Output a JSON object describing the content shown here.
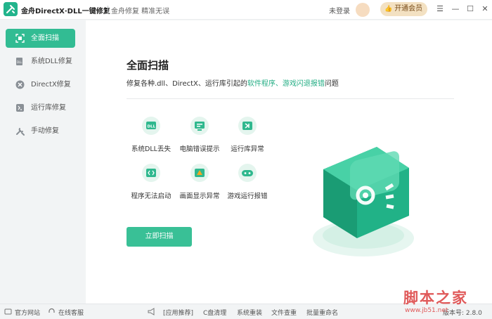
{
  "window": {
    "title": "金舟DirectX·DLL一键修复",
    "slogan": "金舟修复 精准无误",
    "login_label": "未登录",
    "vip_label": "开通会员",
    "controls": [
      "menu-icon",
      "minimize-icon",
      "maximize-icon",
      "close-icon"
    ]
  },
  "sidebar": {
    "items": [
      {
        "label": "全面扫描",
        "icon": "scan-icon",
        "active": true
      },
      {
        "label": "系统DLL修复",
        "icon": "dll-icon",
        "active": false
      },
      {
        "label": "DirectX修复",
        "icon": "directx-icon",
        "active": false
      },
      {
        "label": "运行库修复",
        "icon": "runtime-icon",
        "active": false
      },
      {
        "label": "手动修复",
        "icon": "wrench-icon",
        "active": false
      }
    ]
  },
  "main": {
    "title": "全面扫描",
    "subtitle_prefix": "修复各种.dll、DirectX、运行库引起的",
    "subtitle_highlight": "软件程序、游戏闪退报错",
    "subtitle_suffix": "问题",
    "features": [
      {
        "label": "系统DLL丢失",
        "icon": "dll-file-icon"
      },
      {
        "label": "电脑错误提示",
        "icon": "monitor-error-icon"
      },
      {
        "label": "运行库异常",
        "icon": "vs-runtime-icon"
      },
      {
        "label": "程序无法启动",
        "icon": "code-window-icon"
      },
      {
        "label": "画面显示异常",
        "icon": "warning-display-icon"
      },
      {
        "label": "游戏运行报错",
        "icon": "gamepad-icon"
      }
    ],
    "scan_button": "立即扫描"
  },
  "footer": {
    "website": "官方网站",
    "support": "在线客服",
    "recommend": "[应用推荐]",
    "links": [
      "C盘清理",
      "系统重装",
      "文件查重",
      "批量重命名"
    ],
    "version": "版本号: 2.8.0"
  },
  "watermark": {
    "text": "脚本之家",
    "url": "www.jb51.net"
  },
  "colors": {
    "accent": "#32bc93",
    "highlight": "#23ad84",
    "vip_bg": "#f3e1c2"
  }
}
